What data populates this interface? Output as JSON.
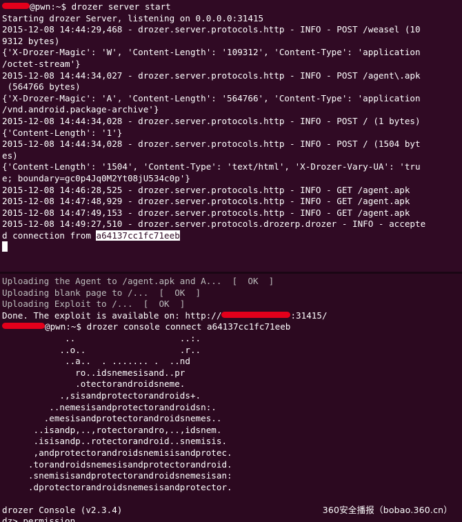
{
  "top_terminal": {
    "prompt_suffix": "@pwn:~$ ",
    "command": "drozer server start",
    "output": [
      "Starting drozer Server, listening on 0.0.0.0:31415",
      "2015-12-08 14:44:29,468 - drozer.server.protocols.http - INFO - POST /weasel (10",
      "9312 bytes)",
      "{'X-Drozer-Magic': 'W', 'Content-Length': '109312', 'Content-Type': 'application",
      "/octet-stream'}",
      "2015-12-08 14:44:34,027 - drozer.server.protocols.http - INFO - POST /agent\\.apk",
      " (564766 bytes)",
      "{'X-Drozer-Magic': 'A', 'Content-Length': '564766', 'Content-Type': 'application",
      "/vnd.android.package-archive'}",
      "2015-12-08 14:44:34,028 - drozer.server.protocols.http - INFO - POST / (1 bytes)",
      "{'Content-Length': '1'}",
      "2015-12-08 14:44:34,028 - drozer.server.protocols.http - INFO - POST / (1504 byt",
      "es)",
      "{'Content-Length': '1504', 'Content-Type': 'text/html', 'X-Drozer-Vary-UA': 'tru",
      "e; boundary=gc0p4Jq0M2Yt08jU534c0p'}",
      "2015-12-08 14:46:28,525 - drozer.server.protocols.http - INFO - GET /agent.apk",
      "2015-12-08 14:47:48,929 - drozer.server.protocols.http - INFO - GET /agent.apk",
      "2015-12-08 14:47:49,153 - drozer.server.protocols.http - INFO - GET /agent.apk",
      "2015-12-08 14:49:27,510 - drozer.server.protocols.drozerp.drozer - INFO - accepte"
    ],
    "last_line_prefix": "d connection from ",
    "connection_id": "a64137cc1fc71eeb"
  },
  "bottom_terminal": {
    "upload_lines": [
      "Uploading the Agent to /agent.apk and A...  [  OK  ]",
      "Uploading blank page to /...  [  OK  ]",
      "Uploading Exploit to /...  [  OK  ]"
    ],
    "done_prefix": "Done. The exploit is available on: http://",
    "done_suffix": ":31415/",
    "prompt_suffix": "@pwn:~$ ",
    "command": "drozer console connect a64137cc1fc71eeb",
    "ascii_art": [
      "            ..                    ..:.",
      "           ..o..                  .r..",
      "            ..a..  . ....... .  ..nd",
      "              ro..idsnemesisand..pr",
      "              .otectorandroidsneme.",
      "           .,sisandprotectorandroids+.",
      "         ..nemesisandprotectorandroidsn:.",
      "        .emesisandprotectorandroidsnemes..",
      "      ..isandp,..,rotectorandro,..,idsnem.",
      "      .isisandp..rotectorandroid..snemisis.",
      "      ,andprotectorandroidsnemisisandprotec.",
      "     .torandroidsnemesisandprotectorandroid.",
      "     .snemisisandprotectorandroidsnemesisan:",
      "     .dprotectorandroidsnemesisandprotector."
    ],
    "console_version": "drozer Console (v2.3.4)",
    "next_prompt": "dz> permission"
  },
  "watermark": "360安全播报（bobao.360.cn）",
  "colors": {
    "terminal_bg": "#300a24",
    "text": "#ffffff",
    "redaction": "#e3001b"
  }
}
